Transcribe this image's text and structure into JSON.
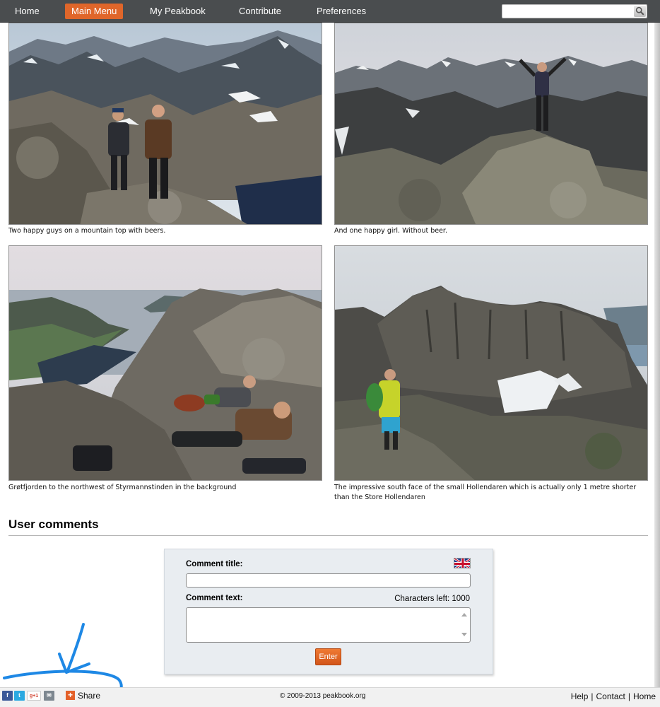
{
  "nav": {
    "items": [
      {
        "label": "Home",
        "active": false
      },
      {
        "label": "Main Menu",
        "active": true
      },
      {
        "label": "My Peakbook",
        "active": false
      },
      {
        "label": "Contribute",
        "active": false
      },
      {
        "label": "Preferences",
        "active": false
      }
    ],
    "search_value": ""
  },
  "photos": [
    {
      "caption": "Two happy guys on a mountain top with beers."
    },
    {
      "caption": "And one happy girl. Without beer."
    },
    {
      "caption": "Grøtfjorden to the northwest of Styrmannstinden in the background"
    },
    {
      "caption": "The impressive south face of the small Hollendaren which is actually only 1 metre shorter than the Store Hollendaren"
    }
  ],
  "comments": {
    "heading": "User comments",
    "title_label": "Comment title:",
    "text_label": "Comment text:",
    "chars_left_label": "Characters left: 1000",
    "title_value": "",
    "text_value": "",
    "submit_label": "Enter",
    "language_flag": "uk-flag-icon"
  },
  "footer": {
    "share_icons": [
      "facebook-icon",
      "twitter-icon",
      "google-plus-icon",
      "email-icon"
    ],
    "share_icon_labels": [
      "f",
      "t",
      "g+1",
      "✉"
    ],
    "share_label": "Share",
    "copyright": "© 2009-2013 peakbook.org",
    "links": [
      "Help",
      "Contact",
      "Home"
    ]
  },
  "colors": {
    "nav_bg": "#4a4d4f",
    "nav_active": "#e0662a",
    "submit_button": "#e0662a",
    "annotation": "#1e88e5"
  }
}
